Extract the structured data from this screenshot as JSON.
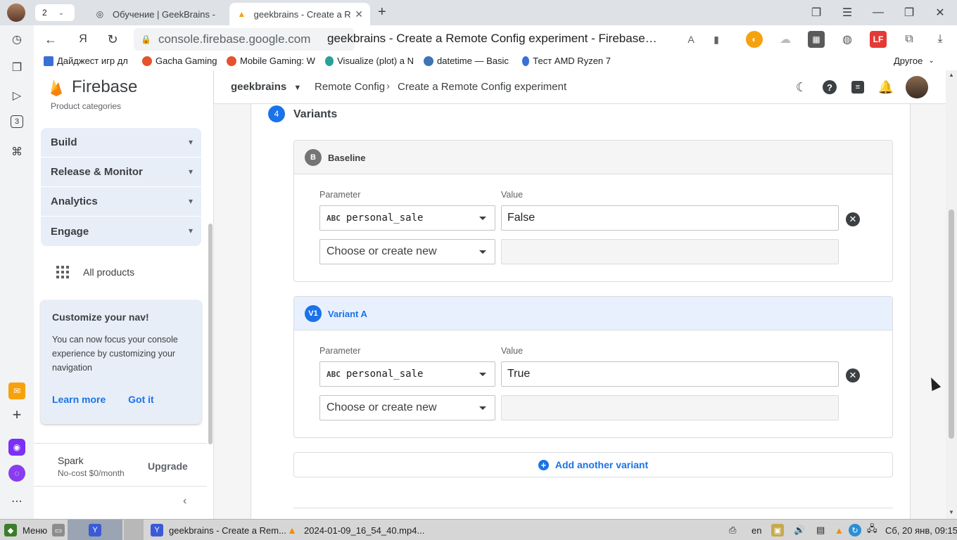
{
  "browser": {
    "tab_count": "2",
    "tabs": [
      {
        "title": "Обучение | GeekBrains -",
        "icon": "geekbrains-icon"
      },
      {
        "title": "geekbrains - Create a Re",
        "icon": "firebase-icon"
      }
    ],
    "url": "console.firebase.google.com",
    "page_title": "geekbrains - Create a Remote Config experiment - Firebase…",
    "bookmarks": [
      "Дайджест игр дл",
      "Gacha Gaming",
      "Mobile Gaming: W",
      "Visualize (plot) a N",
      "datetime — Basic",
      "Тест AMD Ryzen 7"
    ],
    "bookmarks_other": "Другое",
    "left_strip_badge": "3"
  },
  "sidebar": {
    "brand": "Firebase",
    "product_categories": "Product categories",
    "nav": [
      {
        "label": "Build"
      },
      {
        "label": "Release & Monitor"
      },
      {
        "label": "Analytics"
      },
      {
        "label": "Engage"
      }
    ],
    "all_products": "All products",
    "customize": {
      "title": "Customize your nav!",
      "body": "You can now focus your console experience by customizing your navigation",
      "learn_more": "Learn more",
      "got_it": "Got it"
    },
    "plan": {
      "name": "Spark",
      "price": "No-cost $0/month",
      "upgrade": "Upgrade"
    }
  },
  "header": {
    "project": "geekbrains",
    "crumb1": "Remote Config",
    "crumb2": "Create a Remote Config experiment"
  },
  "main": {
    "step_number": "4",
    "step_title": "Variants",
    "variants": [
      {
        "badge": "B",
        "name": "Baseline",
        "param_label": "Parameter",
        "value_label": "Value",
        "param_type": "ABC",
        "param_name": "personal_sale",
        "value": "False",
        "placeholder": "Choose or create new"
      },
      {
        "badge": "V1",
        "name": "Variant A",
        "param_label": "Parameter",
        "value_label": "Value",
        "param_type": "ABC",
        "param_name": "personal_sale",
        "value": "True",
        "placeholder": "Choose or create new"
      }
    ],
    "add_variant": "Add another variant"
  },
  "taskbar": {
    "menu": "Меню",
    "window1": "geekbrains - Create a Rem...",
    "window2": "2024-01-09_16_54_40.mp4...",
    "lang": "en",
    "clock": "Сб, 20 янв, 09:15"
  },
  "colors": {
    "accent": "#1a73e8",
    "baseline_badge": "#757575",
    "variant_badge": "#1a73e8",
    "variant_header_bg": "#e8f0fe",
    "baseline_header_bg": "#f5f5f5"
  }
}
